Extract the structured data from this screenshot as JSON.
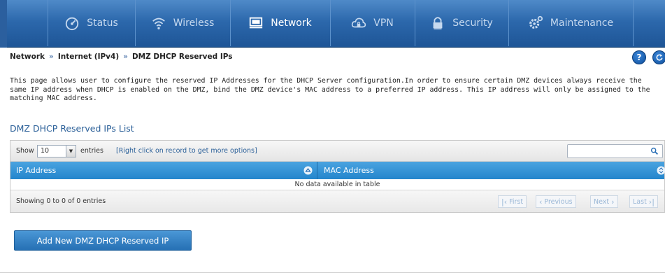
{
  "nav": {
    "items": [
      {
        "label": "Status",
        "icon": "dashboard-gauge-icon"
      },
      {
        "label": "Wireless",
        "icon": "wifi-icon"
      },
      {
        "label": "Network",
        "icon": "monitor-icon",
        "active": true
      },
      {
        "label": "VPN",
        "icon": "cloud-lock-icon"
      },
      {
        "label": "Security",
        "icon": "padlock-icon"
      },
      {
        "label": "Maintenance",
        "icon": "gears-icon"
      }
    ]
  },
  "breadcrumb": {
    "items": [
      "Network",
      "Internet (IPv4)",
      "DMZ DHCP Reserved IPs"
    ],
    "separator": "»"
  },
  "help": {
    "label": "?"
  },
  "description": "This page allows user to configure the reserved IP Addresses for the DHCP Server configuration.In order to ensure certain DMZ devices always receive the same IP address when DHCP is enabled on the DMZ, bind the DMZ device's MAC address to a preferred IP address. This IP address will only be assigned to the matching MAC address.",
  "section_title": "DMZ DHCP Reserved IPs List",
  "table": {
    "show_label": "Show",
    "page_size": "10",
    "entries_label": "entries",
    "hint": "[Right click on record to get more options]",
    "search_value": "",
    "columns": [
      "IP Address",
      "MAC Address"
    ],
    "empty_message": "No data available in table",
    "info": "Showing 0 to 0 of 0 entries",
    "pager": {
      "first": "First",
      "previous": "Previous",
      "next": "Next",
      "last": "Last"
    }
  },
  "add_button": "Add New DMZ DHCP Reserved IP",
  "colors": {
    "nav_bg": "#2c68ac",
    "header_bg": "#2385cc",
    "accent_text": "#2a5f98",
    "button_bg": "#2670b4"
  }
}
